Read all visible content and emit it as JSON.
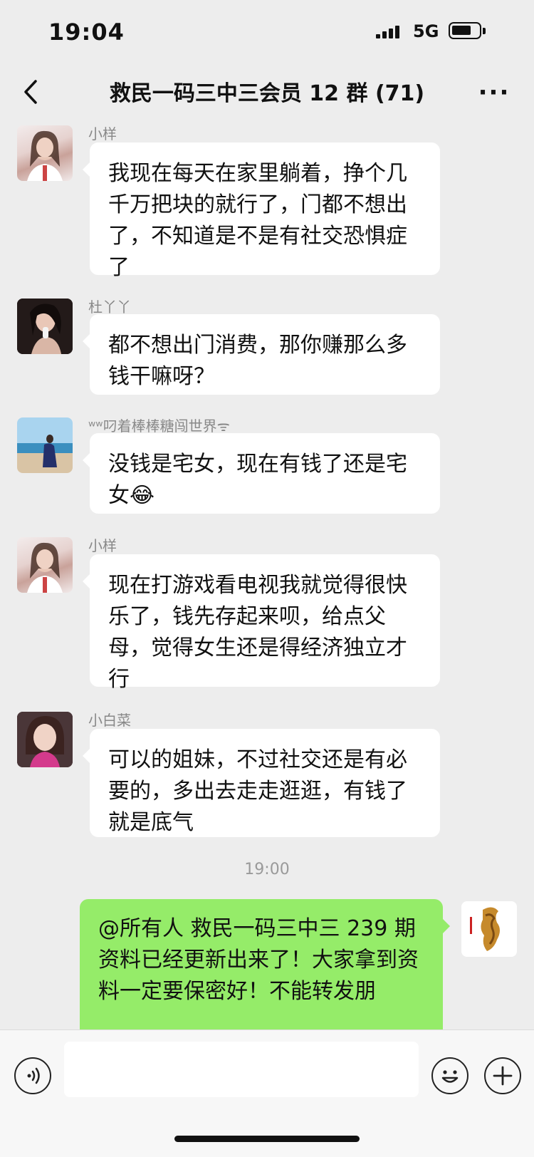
{
  "status_bar": {
    "time": "19:04",
    "network": "5G",
    "battery_level": 0.72
  },
  "header": {
    "title": "救民一码三中三会员 12 群 (71)",
    "more": "···"
  },
  "messages": [
    {
      "sender": "小样",
      "text": "我现在每天在家里躺着，挣个几千万把块的就行了，门都不想出了，不知道是不是有社交恐惧症了"
    },
    {
      "sender": "杜丫丫",
      "text": "都不想出门消费，那你赚那么多钱干嘛呀？"
    },
    {
      "sender": "ʷʷ叼着棒棒糖闯世界ᯤ",
      "text": "没钱是宅女，现在有钱了还是宅女😂"
    },
    {
      "sender": "小样",
      "text": "现在打游戏看电视我就觉得很快乐了，钱先存起来呗，给点父母，觉得女生还是得经济独立才行"
    },
    {
      "sender": "小白菜",
      "text": "可以的姐妹，不过社交还是有必要的，多出去走走逛逛，有钱了就是底气"
    }
  ],
  "timestamp": "19:00",
  "self_message": {
    "text": "@所有人  救民一码三中三 239 期资料已经更新出来了！大家拿到资料一定要保密好！不能转发朋"
  },
  "colors": {
    "background": "#ededed",
    "self_bubble": "#95ec69",
    "bubble": "#ffffff"
  },
  "input_bar": {
    "value": "",
    "icons": [
      "voice-icon",
      "emoji-icon",
      "plus-icon"
    ]
  }
}
